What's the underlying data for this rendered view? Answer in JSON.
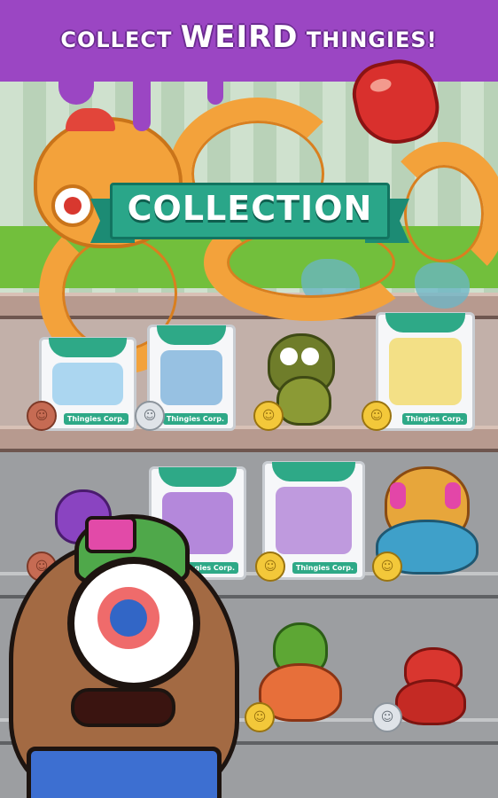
{
  "banner": {
    "word1": "COLLECT",
    "word2": "WEIRD",
    "word3": "THINGIES!"
  },
  "ribbon": {
    "title": "COLLECTION"
  },
  "boxes": [
    {
      "brand": "Thingies Corp.",
      "window_color": "#9ed0ee"
    },
    {
      "brand": "Thingies Corp.",
      "window_color": "#86b7de"
    },
    {
      "brand": "Thingies Corp.",
      "window_color": "#f2dc72"
    },
    {
      "brand": "Thingies Corp.",
      "window_color": "#a874d6"
    },
    {
      "brand": "Thingies Corp.",
      "window_color": "#b58ad9"
    }
  ],
  "coins": [
    {
      "type": "bronze",
      "glyph": "☺"
    },
    {
      "type": "silver",
      "glyph": "☺"
    },
    {
      "type": "gold",
      "glyph": "☺"
    },
    {
      "type": "gold",
      "glyph": "☺"
    },
    {
      "type": "bronze",
      "glyph": "☺"
    },
    {
      "type": "gold",
      "glyph": "☺"
    },
    {
      "type": "gold",
      "glyph": "☺"
    },
    {
      "type": "gold",
      "glyph": "☺"
    },
    {
      "type": "silver",
      "glyph": "☺"
    }
  ],
  "colors": {
    "banner_purple": "#9b46c3",
    "ribbon_teal": "#2aa689",
    "octopus_orange": "#f3a23b"
  }
}
